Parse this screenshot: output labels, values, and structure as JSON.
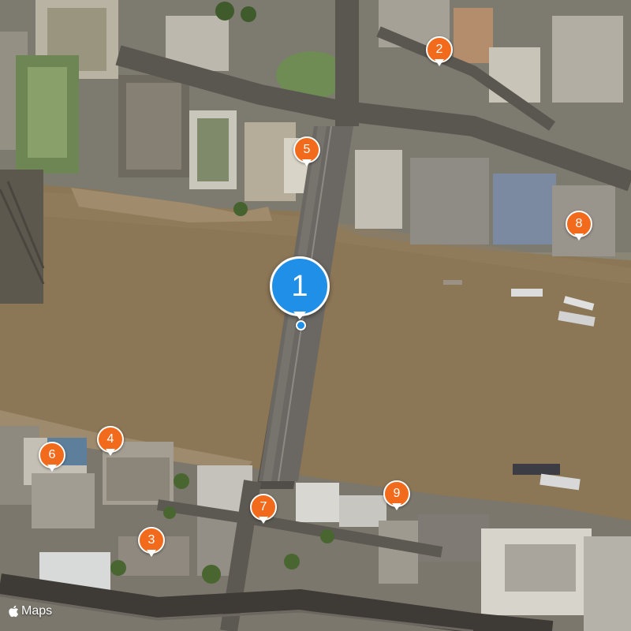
{
  "map": {
    "type": "satellite",
    "attribution": "Maps",
    "selected_pin": "1",
    "colors": {
      "river": "#8b7656",
      "primary_pin": "#1f8fe8",
      "secondary_pin": "#f26a1b"
    }
  },
  "pins": [
    {
      "label": "1",
      "kind": "primary"
    },
    {
      "label": "2",
      "kind": "secondary"
    },
    {
      "label": "3",
      "kind": "secondary"
    },
    {
      "label": "4",
      "kind": "secondary"
    },
    {
      "label": "5",
      "kind": "secondary"
    },
    {
      "label": "6",
      "kind": "secondary"
    },
    {
      "label": "7",
      "kind": "secondary"
    },
    {
      "label": "8",
      "kind": "secondary"
    },
    {
      "label": "9",
      "kind": "secondary"
    }
  ]
}
